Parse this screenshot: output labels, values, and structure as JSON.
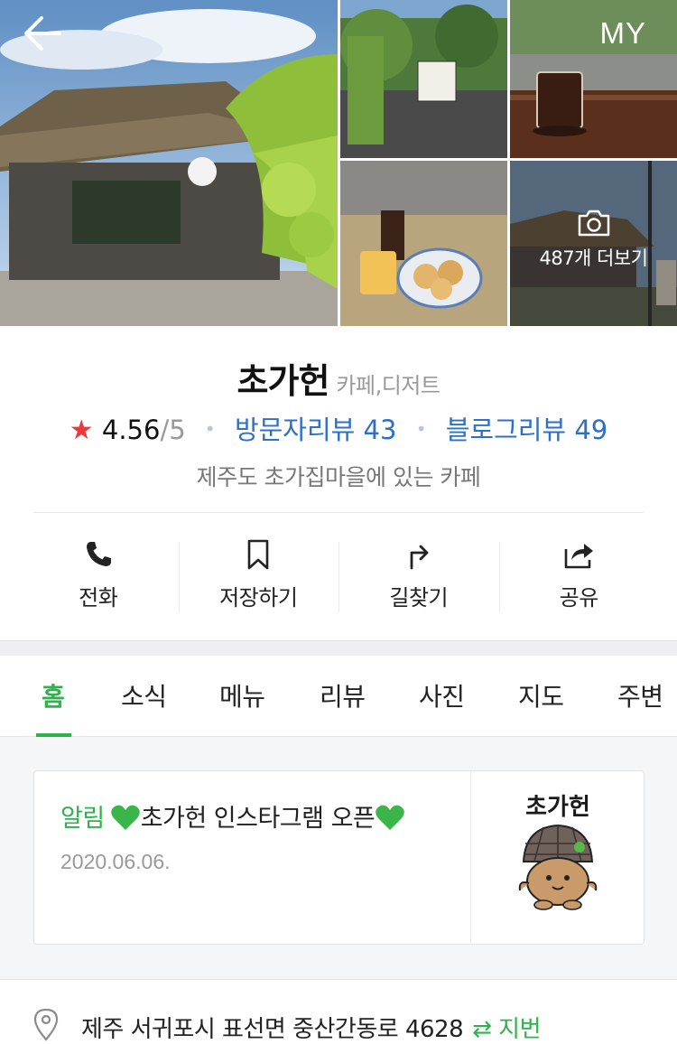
{
  "header": {
    "back_icon": "arrow-left-icon",
    "my_label": "MY"
  },
  "gallery": {
    "more_label": "487개 더보기",
    "more_icon": "camera-icon"
  },
  "place": {
    "name": "초가헌",
    "category": "카페,디저트",
    "rating_star": "★",
    "rating": "4.56",
    "rating_max": "/5",
    "separator": "•",
    "visitor_reviews_label": "방문자리뷰 43",
    "blog_reviews_label": "블로그리뷰 49",
    "description": "제주도 초가집마을에 있는 카페"
  },
  "actions": [
    {
      "label": "전화",
      "icon": "phone-icon"
    },
    {
      "label": "저장하기",
      "icon": "bookmark-icon"
    },
    {
      "label": "길찾기",
      "icon": "directions-icon"
    },
    {
      "label": "공유",
      "icon": "share-icon"
    }
  ],
  "tabs": [
    {
      "label": "홈",
      "active": true
    },
    {
      "label": "소식"
    },
    {
      "label": "메뉴"
    },
    {
      "label": "리뷰"
    },
    {
      "label": "사진"
    },
    {
      "label": "지도"
    },
    {
      "label": "주변"
    }
  ],
  "news": {
    "tag": "알림",
    "title": "초가헌 인스타그램 오픈",
    "date": "2020.06.06.",
    "thumb_text": "초가헌"
  },
  "address": {
    "text": "제주 서귀포시 표선면 중산간동로 4628",
    "jibun_label": "⇄ 지번"
  },
  "colors": {
    "accent_green": "#2fb24b",
    "link_blue": "#2e6fc7",
    "star_red": "#e83a3a"
  }
}
